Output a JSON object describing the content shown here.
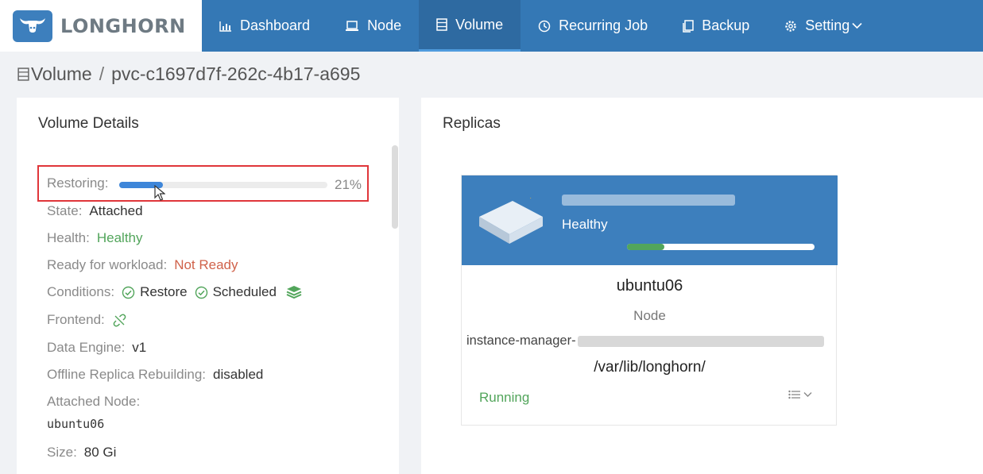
{
  "app": {
    "logo_text": "LONGHORN"
  },
  "nav": {
    "items": [
      {
        "label": "Dashboard",
        "icon": "bar-chart-icon"
      },
      {
        "label": "Node",
        "icon": "laptop-icon"
      },
      {
        "label": "Volume",
        "icon": "database-icon",
        "active": true
      },
      {
        "label": "Recurring Job",
        "icon": "clock-icon"
      },
      {
        "label": "Backup",
        "icon": "copy-icon"
      },
      {
        "label": "Setting",
        "icon": "gear-icon",
        "has_dropdown": true
      }
    ]
  },
  "breadcrumb": {
    "section": "Volume",
    "separator": "/",
    "current": "pvc-c1697d7f-262c-4b17-a695"
  },
  "volume_details": {
    "title": "Volume Details",
    "restoring": {
      "label": "Restoring:",
      "percent": 21,
      "percent_text": "21%"
    },
    "state": {
      "label": "State:",
      "value": "Attached"
    },
    "health": {
      "label": "Health:",
      "value": "Healthy"
    },
    "ready": {
      "label": "Ready for workload:",
      "value": "Not Ready"
    },
    "conditions": {
      "label": "Conditions:",
      "items": [
        "Restore",
        "Scheduled"
      ]
    },
    "frontend": {
      "label": "Frontend:"
    },
    "data_engine": {
      "label": "Data Engine:",
      "value": "v1"
    },
    "offline_rebuild": {
      "label": "Offline Replica Rebuilding:",
      "value": "disabled"
    },
    "attached_node": {
      "label": "Attached Node:",
      "value": "ubuntu06"
    },
    "size": {
      "label": "Size:",
      "value": "80 Gi"
    }
  },
  "replicas": {
    "title": "Replicas",
    "card": {
      "health": "Healthy",
      "usage_fraction": 0.2,
      "node": "ubuntu06",
      "node_label": "Node",
      "instance_manager": "instance-manager-",
      "path": "/var/lib/longhorn/",
      "status": "Running"
    }
  },
  "colors": {
    "header_blue": "#3478b5",
    "active_tab": "#2e6aa1",
    "healthy_green": "#52a55b",
    "not_ready_red": "#d0624a",
    "progress_blue": "#3e86d9",
    "highlight_red": "#e0363a"
  }
}
